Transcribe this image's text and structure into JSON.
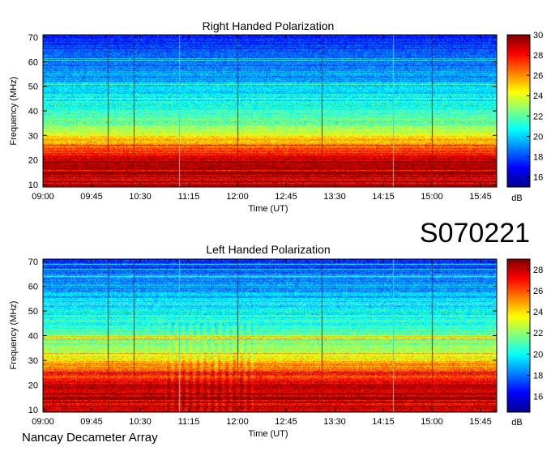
{
  "header": {
    "date_code": "S070221",
    "instrument": "Nancay Decameter Array"
  },
  "colors": {
    "colormap": [
      "#00008f",
      "#0000ff",
      "#0080ff",
      "#00ffff",
      "#80ff80",
      "#ffff00",
      "#ff8000",
      "#ff0000",
      "#800000"
    ],
    "spike_line": "#8b1a1a",
    "text": "#000000",
    "background": "#ffffff"
  },
  "chart_data": [
    {
      "type": "heatmap",
      "title": "Right Handed Polarization",
      "xlabel": "Time (UT)",
      "ylabel": "Frequency (MHz)",
      "xticks": [
        "09:00",
        "09:45",
        "10:30",
        "11:15",
        "12:00",
        "12:45",
        "13:30",
        "14:15",
        "15:00",
        "15:45"
      ],
      "xlim_hours": [
        9.0,
        16.0
      ],
      "yticks": [
        10,
        20,
        30,
        40,
        50,
        60,
        70
      ],
      "ylim": [
        9,
        71
      ],
      "colorbar": {
        "label": "dB",
        "ticks": [
          16,
          18,
          20,
          22,
          24,
          26,
          28,
          30
        ],
        "range": [
          15,
          30
        ]
      },
      "spike_lines_hours": [
        10.0,
        10.4,
        11.1,
        12.0,
        13.3,
        14.4,
        15.0
      ],
      "profile": {
        "low_freq_intensity_db": 29,
        "mid_freq_intensity_db": 22,
        "high_freq_intensity_db": 17
      }
    },
    {
      "type": "heatmap",
      "title": "Left Handed Polarization",
      "xlabel": "Time (UT)",
      "ylabel": "Frequency (MHz)",
      "xticks": [
        "09:00",
        "09:45",
        "10:30",
        "11:15",
        "12:00",
        "12:45",
        "13:30",
        "14:15",
        "15:00",
        "15:45"
      ],
      "xlim_hours": [
        9.0,
        16.0
      ],
      "yticks": [
        10,
        20,
        30,
        40,
        50,
        60,
        70
      ],
      "ylim": [
        9,
        71
      ],
      "colorbar": {
        "label": "dB",
        "ticks": [
          16,
          18,
          20,
          22,
          24,
          26,
          28
        ],
        "range": [
          14.5,
          29
        ]
      },
      "spike_lines_hours": [
        10.0,
        10.4,
        11.1,
        12.0,
        13.3,
        14.4,
        15.0
      ],
      "profile": {
        "low_freq_intensity_db": 28,
        "mid_freq_intensity_db": 22,
        "high_freq_intensity_db": 17
      }
    }
  ]
}
